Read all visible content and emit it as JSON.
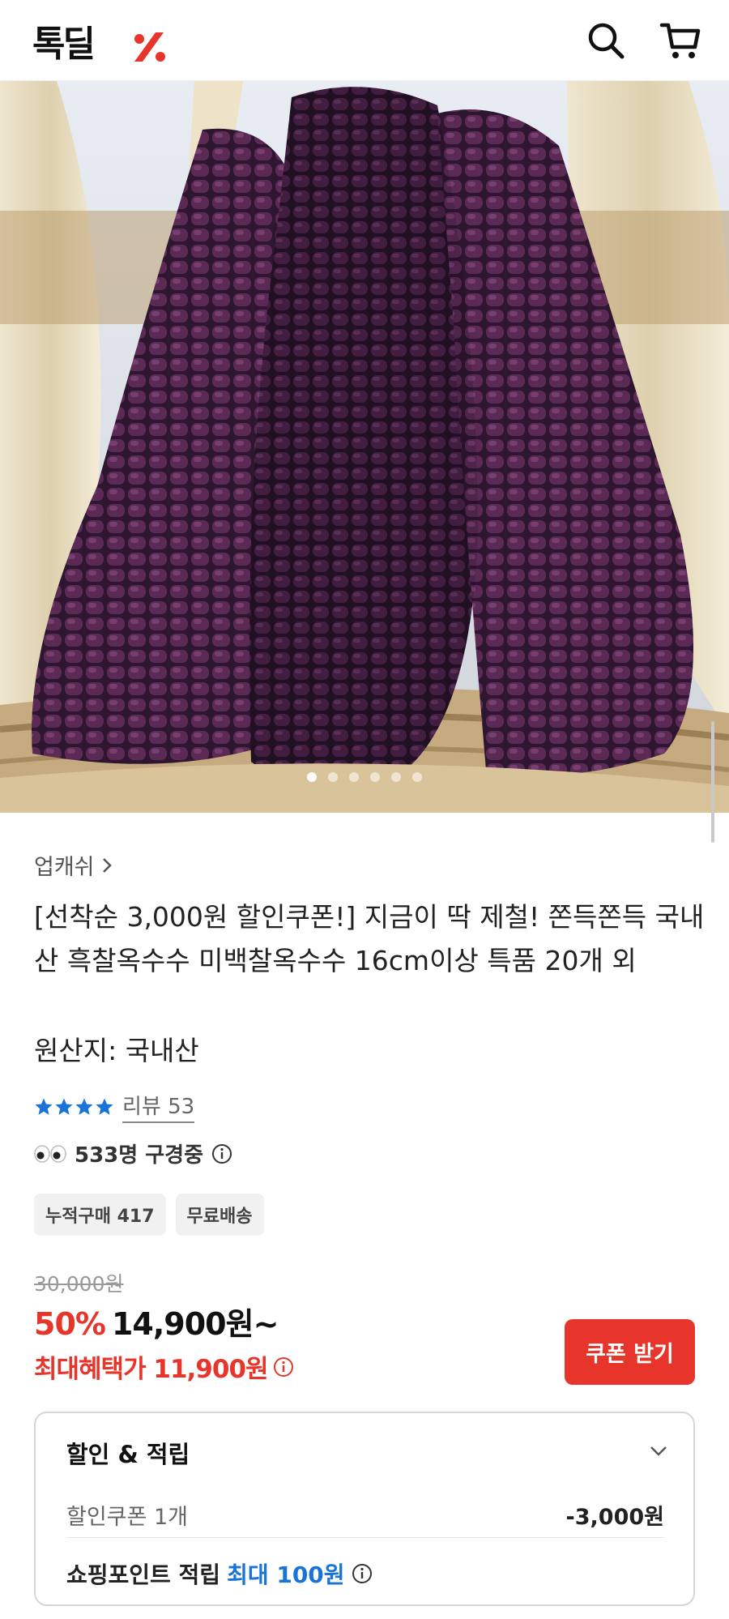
{
  "header": {
    "logo": "톡딜",
    "icons": [
      "search-icon",
      "cart-icon"
    ]
  },
  "gallery": {
    "image_alt": "흑찰옥수수",
    "slide_count": 6,
    "active_index": 0
  },
  "product": {
    "seller": "업캐쉬",
    "title": "[선착순 3,000원 할인쿠폰!] 지금이 딱 제철! 쫀득쫀득 국내산 흑찰옥수수 미백찰옥수수 16cm이상 특품 20개 외",
    "origin": "원산지: 국내산",
    "rating_stars": 4,
    "review_label": "리뷰 53",
    "viewing": "533명 구경중",
    "tags": [
      "누적구매 417",
      "무료배송"
    ]
  },
  "pricing": {
    "original_price": "30,000원",
    "discount_rate": "50%",
    "sale_price": "14,900원~",
    "max_benefit": "최대혜택가 11,900원",
    "coupon_button": "쿠폰 받기"
  },
  "benefits": {
    "title": "할인 & 적립",
    "coupon_label": "할인쿠폰 1개",
    "coupon_amount": "-3,000원",
    "points_label": "쇼핑포인트 적립",
    "points_value": "최대 100원"
  },
  "colors": {
    "accent_red": "#e8352b",
    "star_blue": "#1a73d9",
    "link_blue": "#1a73d9"
  }
}
